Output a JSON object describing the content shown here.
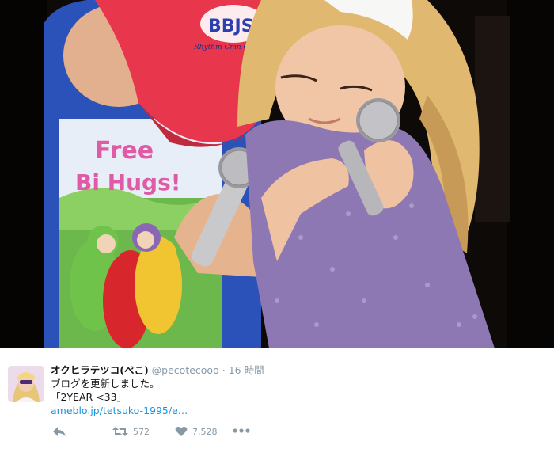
{
  "tweet": {
    "display_name": "オクヒラテツコ(ぺこ)",
    "screen_name": "@pecotecooo",
    "separator": "·",
    "timestamp": "16 時間",
    "lines": [
      "ブログを更新しました。",
      "「2YEAR <33」"
    ],
    "link": "ameblo.jp/tetsuko-1995/e…"
  },
  "actions": {
    "reply_icon": "reply-icon",
    "retweet_icon": "retweet-icon",
    "retweet_count": "572",
    "like_icon": "heart-icon",
    "like_count": "7,528",
    "more_icon": "more-icon"
  },
  "photo": {
    "cap_text": "BBJS",
    "cap_subtext": "Rhythm Cmn Cmn dumb",
    "shirt_text_1": "Free",
    "shirt_text_2": "Bi Hugs!"
  },
  "colors": {
    "link": "#1b95e0",
    "muted": "#8899a6",
    "text": "#14171a",
    "shirt_blue": "#2b52b8",
    "cap_red": "#e8364c",
    "dress_purple": "#8d78b4"
  }
}
